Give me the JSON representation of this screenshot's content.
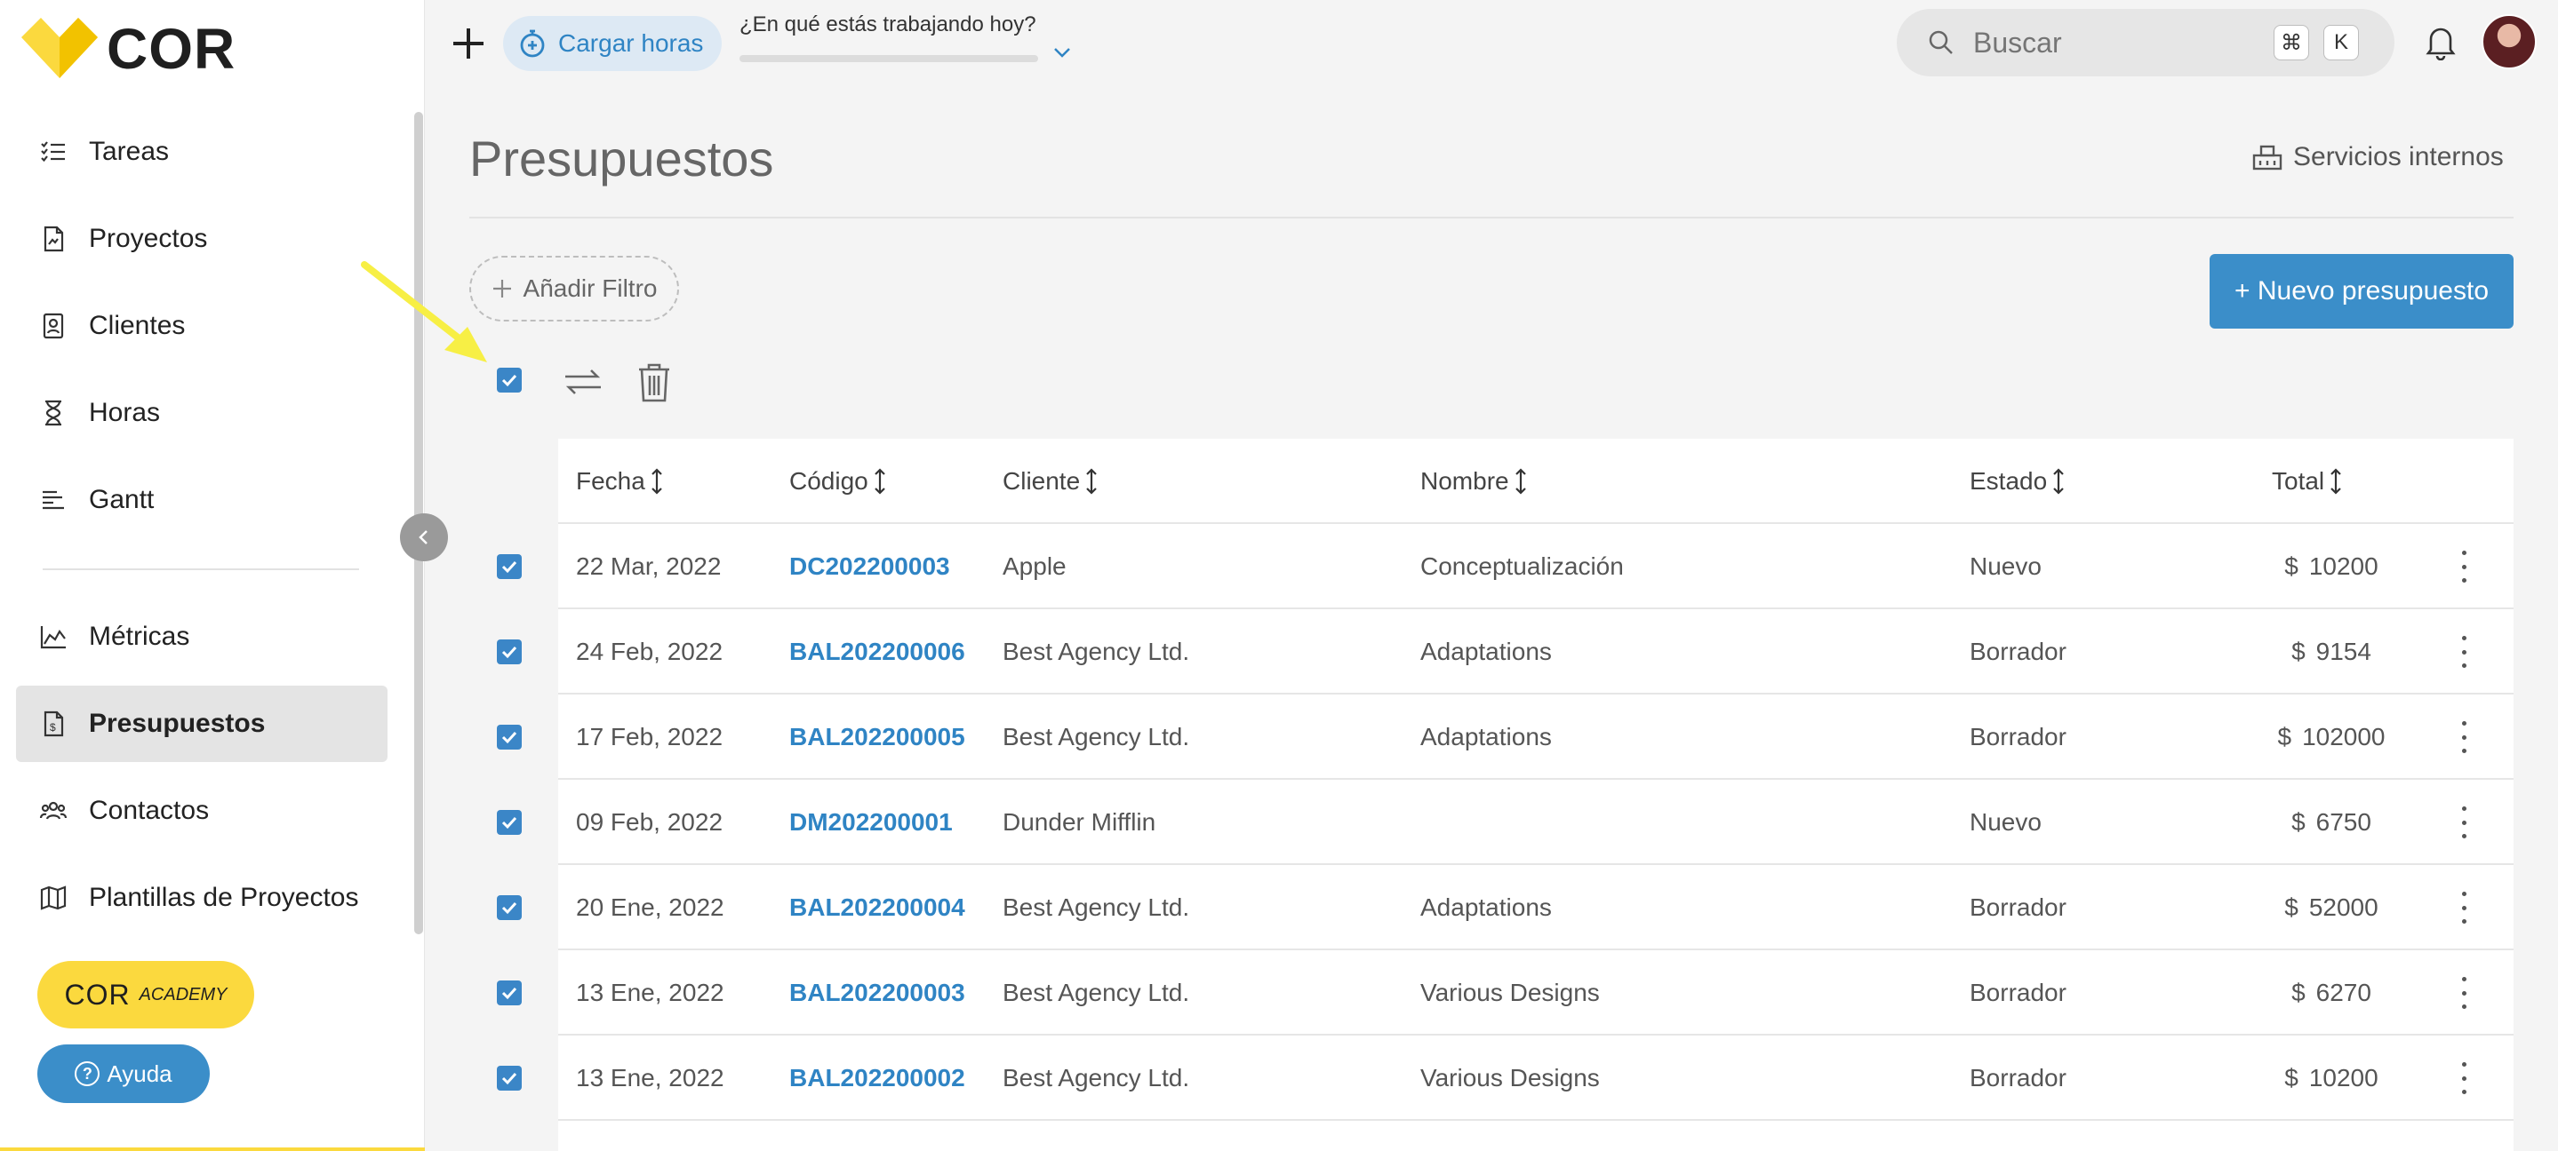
{
  "app": {
    "logo_text": "COR",
    "brand_color": "#fbd93e",
    "accent_color": "#3b8ec9"
  },
  "sidebar": {
    "items": [
      {
        "label": "Tareas",
        "icon": "checklist-icon"
      },
      {
        "label": "Proyectos",
        "icon": "document-icon"
      },
      {
        "label": "Clientes",
        "icon": "contact-card-icon"
      },
      {
        "label": "Horas",
        "icon": "hourglass-icon"
      },
      {
        "label": "Gantt",
        "icon": "gantt-icon"
      },
      {
        "label": "Métricas",
        "icon": "chart-area-icon"
      },
      {
        "label": "Presupuestos",
        "icon": "invoice-icon",
        "active": true
      },
      {
        "label": "Contactos",
        "icon": "people-icon"
      },
      {
        "label": "Plantillas de Proyectos",
        "icon": "map-icon"
      }
    ],
    "academy_label": "COR",
    "academy_sub": "ACADEMY",
    "help_label": "Ayuda"
  },
  "topbar": {
    "load_hours_label": "Cargar horas",
    "working_question": "¿En qué estás trabajando hoy?",
    "search_placeholder": "Buscar",
    "shortcut_cmd": "⌘",
    "shortcut_key": "K"
  },
  "page": {
    "title": "Presupuestos",
    "internal_services_label": "Servicios internos",
    "add_filter_label": "Añadir Filtro",
    "new_budget_label": "+ Nuevo presupuesto"
  },
  "table": {
    "columns": [
      "Fecha",
      "Código",
      "Cliente",
      "Nombre",
      "Estado",
      "Total"
    ],
    "currency": "$",
    "rows": [
      {
        "fecha": "22 Mar, 2022",
        "codigo": "DC202200003",
        "cliente": "Apple",
        "nombre": "Conceptualización",
        "estado": "Nuevo",
        "total": "10200",
        "selected": true
      },
      {
        "fecha": "24 Feb, 2022",
        "codigo": "BAL202200006",
        "cliente": "Best Agency Ltd.",
        "nombre": "Adaptations",
        "estado": "Borrador",
        "total": "9154",
        "selected": true
      },
      {
        "fecha": "17 Feb, 2022",
        "codigo": "BAL202200005",
        "cliente": "Best Agency Ltd.",
        "nombre": "Adaptations",
        "estado": "Borrador",
        "total": "102000",
        "selected": true
      },
      {
        "fecha": "09 Feb, 2022",
        "codigo": "DM202200001",
        "cliente": "Dunder Mifflin",
        "nombre": "",
        "estado": "Nuevo",
        "total": "6750",
        "selected": true
      },
      {
        "fecha": "20 Ene, 2022",
        "codigo": "BAL202200004",
        "cliente": "Best Agency Ltd.",
        "nombre": "Adaptations",
        "estado": "Borrador",
        "total": "52000",
        "selected": true
      },
      {
        "fecha": "13 Ene, 2022",
        "codigo": "BAL202200003",
        "cliente": "Best Agency Ltd.",
        "nombre": "Various Designs",
        "estado": "Borrador",
        "total": "6270",
        "selected": true
      },
      {
        "fecha": "13 Ene, 2022",
        "codigo": "BAL202200002",
        "cliente": "Best Agency Ltd.",
        "nombre": "Various Designs",
        "estado": "Borrador",
        "total": "10200",
        "selected": true
      }
    ]
  }
}
